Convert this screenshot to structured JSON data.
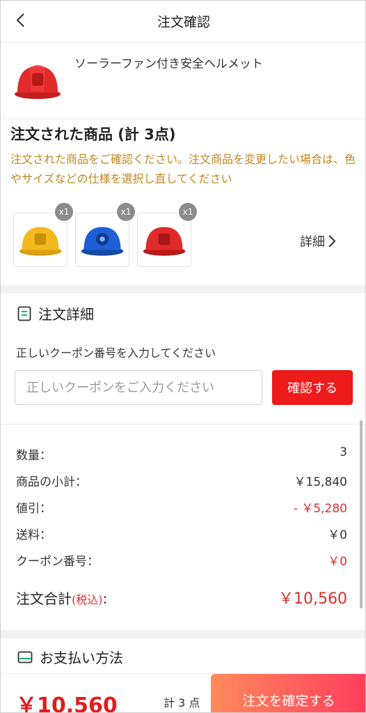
{
  "header": {
    "title": "注文確認"
  },
  "product": {
    "name": "ソーラーファン付き安全ヘルメット"
  },
  "ordered_items": {
    "heading": "注文された商品 (計 3点)",
    "note": "注文された商品をご確認ください。注文商品を変更したい場合は、色やサイズなどの仕様を選択し直してください",
    "items": [
      {
        "color": "#f4b91b",
        "qty": "x1"
      },
      {
        "color": "#1e5fd8",
        "qty": "x1"
      },
      {
        "color": "#e12a2a",
        "qty": "x1"
      }
    ],
    "detail_label": "詳細"
  },
  "order_detail": {
    "title": "注文詳細",
    "coupon_label": "正しいクーポン番号を入力してください",
    "coupon_placeholder": "正しいクーポンをご入力ください",
    "confirm_label": "確認する"
  },
  "summary": {
    "qty_label": "数量：",
    "qty_value": "3",
    "subtotal_label": "商品の小計：",
    "subtotal_value": "￥15,840",
    "discount_label": "値引：",
    "discount_value": "- ￥5,280",
    "shipping_label": "送料：",
    "shipping_value": "￥0",
    "coupon_label": "クーポン番号：",
    "coupon_value": "￥0",
    "total_label": "注文合計",
    "total_tax": "(税込)",
    "total_colon": ":",
    "total_value": "￥10,560"
  },
  "payment": {
    "title": "お支払い方法"
  },
  "bottom_bar": {
    "price": "￥10,560",
    "count": "計 3 点",
    "submit_label": "注文を確定する"
  },
  "colors": {
    "accent_red": "#ee1b1b",
    "note_orange": "#c2861c"
  }
}
